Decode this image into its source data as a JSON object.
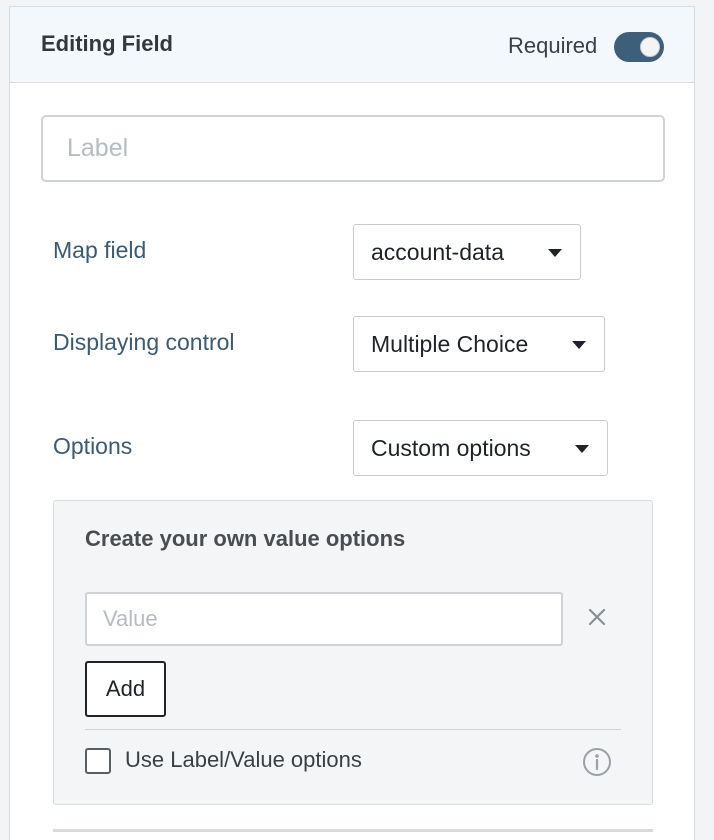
{
  "header": {
    "title": "Editing Field",
    "required_label": "Required",
    "required_on": true
  },
  "label_field": {
    "value": "",
    "placeholder": "Label"
  },
  "map_field": {
    "label": "Map field",
    "selected": "account-data"
  },
  "displaying_control": {
    "label": "Displaying control",
    "selected": "Multiple Choice"
  },
  "options": {
    "label": "Options",
    "selected": "Custom options"
  },
  "custom_options": {
    "heading": "Create your own value options",
    "value_placeholder": "Value",
    "add_label": "Add",
    "use_label_value_label": "Use Label/Value options",
    "use_label_value_checked": false
  },
  "icons": {
    "remove": "close-icon",
    "info": "info-icon",
    "dropdown": "chevron-down-icon"
  },
  "colors": {
    "accent": "#3e5f7a",
    "label_text": "#3a5a74",
    "header_bg": "#f3f8fd"
  }
}
